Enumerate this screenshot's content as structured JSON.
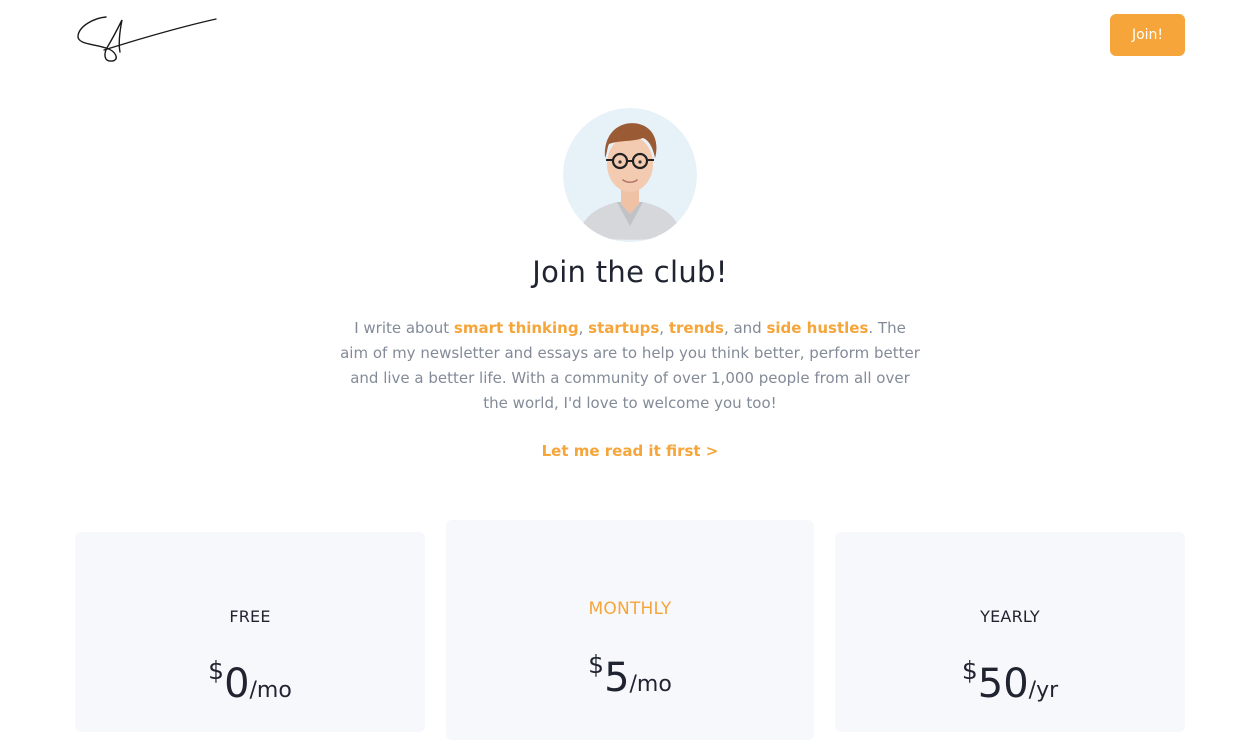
{
  "colors": {
    "accent": "#f5a53a",
    "text_dark": "#1f2430",
    "text_muted": "#838b98",
    "card_bg": "#f7f8fb"
  },
  "header": {
    "logo_icon": "signature-logo",
    "join_label": "Join!"
  },
  "hero": {
    "avatar_icon": "author-portrait",
    "title": "Join the club!",
    "desc_intro": "I write about ",
    "topics": [
      "smart thinking",
      "startups",
      "trends",
      "side hustles"
    ],
    "sep1": ", ",
    "sep2": ", ",
    "sep3": ", and ",
    "desc_rest": ". The aim of my newsletter and essays are to help you think better, perform better and live a better life. With a community of over 1,000 people from all over the world, I'd love to welcome you too!",
    "read_first_label": "Let me read it first >"
  },
  "plans": [
    {
      "name": "FREE",
      "currency": "$",
      "amount": "0",
      "period": "/mo"
    },
    {
      "name": "MONTHLY",
      "currency": "$",
      "amount": "5",
      "period": "/mo"
    },
    {
      "name": "YEARLY",
      "currency": "$",
      "amount": "50",
      "period": "/yr"
    }
  ]
}
